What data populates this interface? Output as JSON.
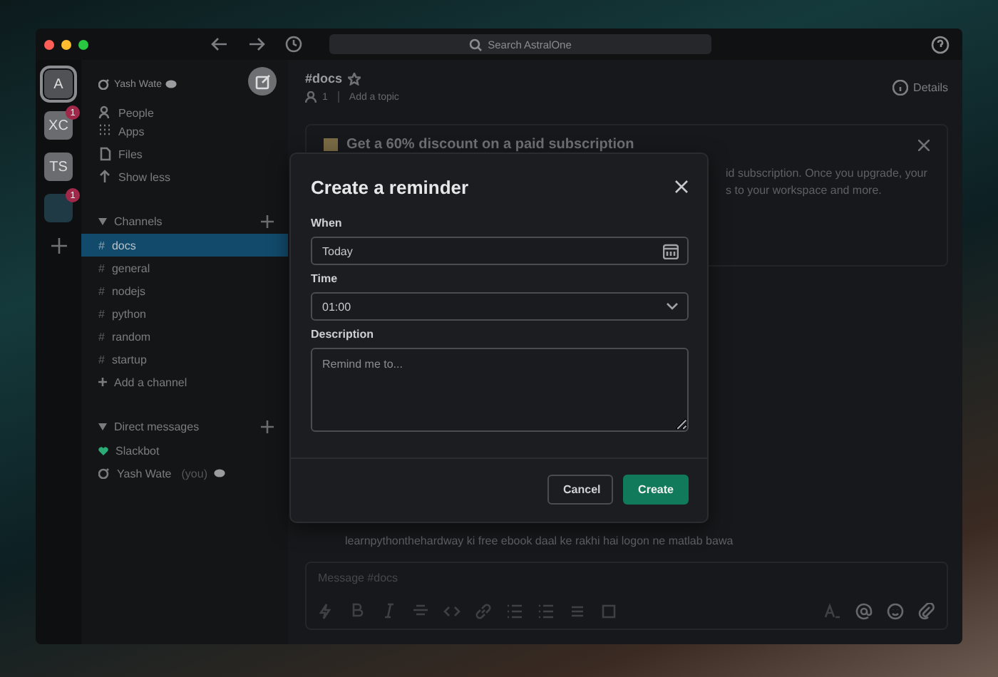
{
  "titlebar": {
    "search": {
      "placeholder": "Search AstralOne"
    }
  },
  "workspaces": [
    {
      "kind": "letters",
      "label": "A",
      "selected": true
    },
    {
      "kind": "letters",
      "label": "XC",
      "badge": "1",
      "selected": false
    },
    {
      "kind": "letters",
      "label": "TS",
      "selected": false
    },
    {
      "kind": "image",
      "badge": "1",
      "selected": false
    }
  ],
  "sidebar": {
    "user": "Yash Wate",
    "nav": [
      "People",
      "Apps",
      "Files",
      "Show less"
    ],
    "channels_header": "Channels",
    "channels": [
      {
        "prefix": "#",
        "name": "docs",
        "selected": true
      },
      {
        "prefix": "#",
        "name": "general",
        "selected": false
      },
      {
        "prefix": "#",
        "name": "nodejs",
        "selected": false
      },
      {
        "prefix": "#",
        "name": "python",
        "selected": false
      },
      {
        "prefix": "#",
        "name": "random",
        "selected": false
      },
      {
        "prefix": "#",
        "name": "startup",
        "selected": false
      }
    ],
    "add_channel": "Add a channel",
    "dm_header": "Direct messages",
    "dms": [
      {
        "kind": "bot",
        "name": "Slackbot"
      },
      {
        "kind": "self",
        "name": "Yash Wate",
        "suffix": "(you)"
      }
    ]
  },
  "header": {
    "channel": "#docs",
    "members": "1",
    "topic": "Add a topic",
    "details": "Details"
  },
  "banner": {
    "title": "Get a 60% discount on a paid subscription",
    "lines": [
      "id subscription. Once you upgrade, your",
      "s to your workspace and more."
    ]
  },
  "message": "learnpythonthehardway ki free ebook daal ke rakhi hai logon ne matlab bawa",
  "composer": {
    "placeholder": "Message #docs"
  },
  "modal": {
    "title": "Create a reminder",
    "fields": [
      {
        "kind": "date",
        "label": "When",
        "value": "Today"
      },
      {
        "kind": "select",
        "label": "Time",
        "value": "01:00"
      },
      {
        "kind": "textarea",
        "label": "Description",
        "placeholder": "Remind me to..."
      }
    ],
    "buttons": [
      {
        "kind": "secondary",
        "label": "Cancel"
      },
      {
        "kind": "primary",
        "label": "Create"
      }
    ]
  }
}
